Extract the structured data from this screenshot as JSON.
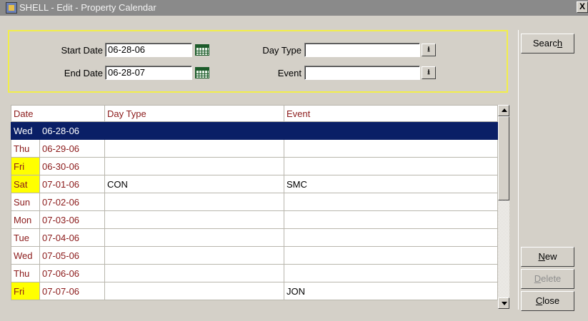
{
  "window": {
    "title": "SHELL - Edit - Property Calendar",
    "close_glyph": "X"
  },
  "filters": {
    "start_date_label": "Start Date",
    "start_date_value": "06-28-06",
    "end_date_label": "End Date",
    "end_date_value": "06-28-07",
    "day_type_label": "Day Type",
    "day_type_value": "",
    "event_label": "Event",
    "event_value": ""
  },
  "grid": {
    "columns": [
      "Date",
      "Day Type",
      "Event"
    ],
    "rows": [
      {
        "day": "Wed",
        "date": "06-28-06",
        "day_type": "",
        "event": ""
      },
      {
        "day": "Thu",
        "date": "06-29-06",
        "day_type": "",
        "event": ""
      },
      {
        "day": "Fri",
        "date": "06-30-06",
        "day_type": "",
        "event": ""
      },
      {
        "day": "Sat",
        "date": "07-01-06",
        "day_type": "CON",
        "event": "SMC"
      },
      {
        "day": "Sun",
        "date": "07-02-06",
        "day_type": "",
        "event": ""
      },
      {
        "day": "Mon",
        "date": "07-03-06",
        "day_type": "",
        "event": ""
      },
      {
        "day": "Tue",
        "date": "07-04-06",
        "day_type": "",
        "event": ""
      },
      {
        "day": "Wed",
        "date": "07-05-06",
        "day_type": "",
        "event": ""
      },
      {
        "day": "Thu",
        "date": "07-06-06",
        "day_type": "",
        "event": ""
      },
      {
        "day": "Fri",
        "date": "07-07-06",
        "day_type": "",
        "event": "JON"
      }
    ]
  },
  "buttons": {
    "search": {
      "pre": "Searc",
      "ul": "h",
      "post": ""
    },
    "new": {
      "pre": "",
      "ul": "N",
      "post": "ew"
    },
    "delete": {
      "pre": "",
      "ul": "D",
      "post": "elete"
    },
    "close": {
      "pre": "",
      "ul": "C",
      "post": "lose"
    }
  },
  "colors": {
    "selection": "#0a1f66",
    "weekend_highlight": "#ffff00",
    "filter_border": "#f2ee4a",
    "label_text": "#8b1a1a"
  },
  "icons": {
    "calendar": "calendar-icon",
    "dropdown": "dropdown-arrow-icon"
  }
}
